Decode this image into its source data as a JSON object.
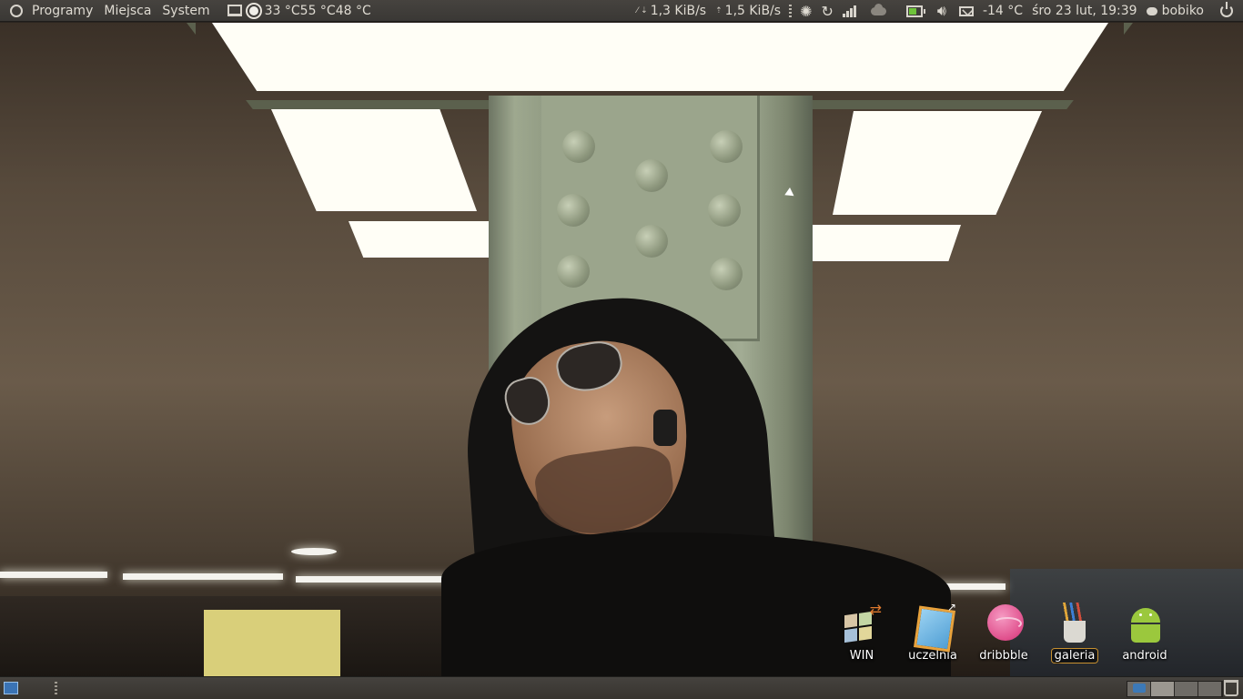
{
  "top_panel": {
    "menus": [
      "Programy",
      "Miejsca",
      "System"
    ],
    "temperatures": "33 °C55 °C48 °C",
    "net_down": "1,3 KiB/s",
    "net_up": "1,5 KiB/s",
    "weather": "-14 °C",
    "datetime": "śro 23 lut, 19:39",
    "user": "bobiko",
    "icons": [
      "ubuntu-logo-icon",
      "monitor-icon",
      "sun-icon",
      "network-icon",
      "swirl-icon",
      "refresh-icon",
      "signal-icon",
      "cloud-icon",
      "battery-icon",
      "volume-icon",
      "mail-icon",
      "chat-icon",
      "power-icon"
    ]
  },
  "desktop": {
    "icons": [
      {
        "label": "WIN",
        "icon": "windows-icon"
      },
      {
        "label": "uczelnia",
        "icon": "tablet-shortcut-icon"
      },
      {
        "label": "dribbble",
        "icon": "dribbble-icon"
      },
      {
        "label": "galeria",
        "icon": "pencil-cup-icon",
        "selected": true
      },
      {
        "label": "android",
        "icon": "android-icon"
      }
    ]
  },
  "bottom_panel": {
    "workspaces": 4,
    "active_workspace": 2,
    "icons": [
      "show-desktop-icon",
      "workspace-switcher",
      "trash-icon"
    ]
  },
  "colors": {
    "panel_bg": "#3f3c39",
    "panel_text": "#dfdbd2",
    "battery_green": "#6ec33a",
    "selected_outline": "#c7902f"
  }
}
